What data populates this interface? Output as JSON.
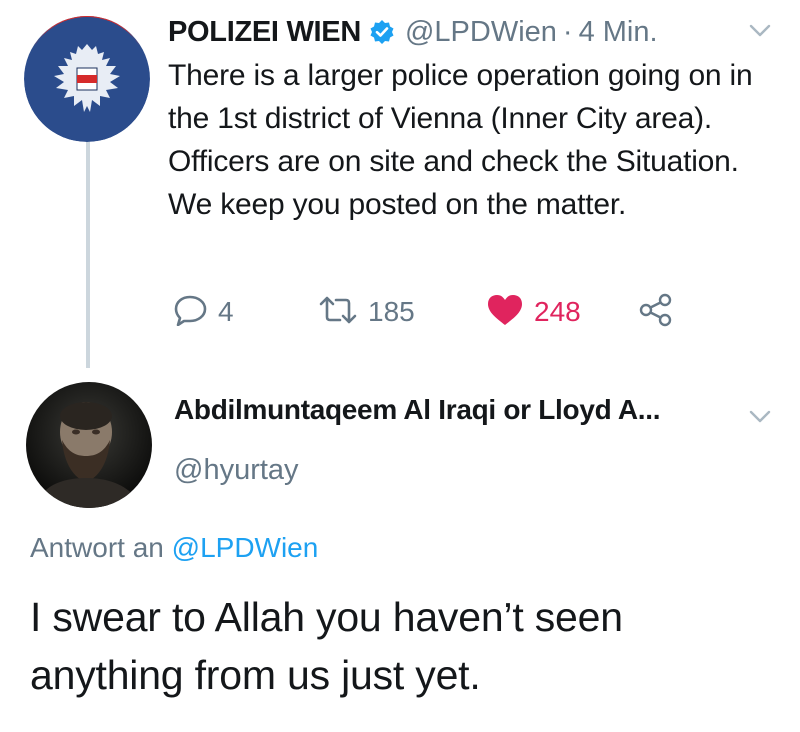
{
  "tweet1": {
    "name": "POLIZEI WIEN",
    "handle": "@LPDWien",
    "separator": "·",
    "time": "4 Min.",
    "text": "There is a larger police operation going on in the 1st district of Vienna (Inner City area). Officers are on site and check the Situation. We keep you posted on the matter.",
    "replies": "4",
    "retweets": "185",
    "likes": "248",
    "verified_icon": "verified-badge-icon",
    "colors": {
      "like": "#e0245e",
      "verified": "#1da1f2",
      "muted": "#657786"
    }
  },
  "tweet2": {
    "name": "Abdilmuntaqeem Al Iraqi or Lloyd A...",
    "handle": "@hyurtay",
    "reply_prefix": "Antwort an",
    "reply_mention": "@LPDWien",
    "text": "I swear to Allah you haven’t seen anything from us just yet.",
    "colors": {
      "mention": "#1da1f2"
    }
  }
}
